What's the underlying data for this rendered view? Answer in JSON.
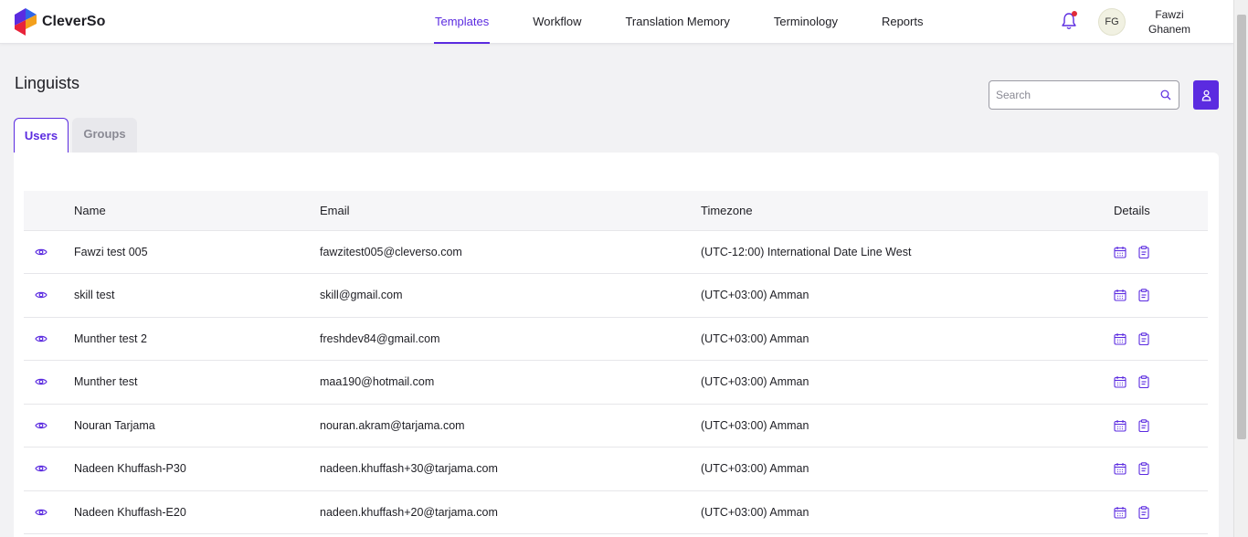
{
  "brand": {
    "name": "CleverSo",
    "accent": "#5b2be0"
  },
  "nav": {
    "items": [
      {
        "label": "Templates",
        "active": true
      },
      {
        "label": "Workflow",
        "active": false
      },
      {
        "label": "Translation Memory",
        "active": false
      },
      {
        "label": "Terminology",
        "active": false
      },
      {
        "label": "Reports",
        "active": false
      }
    ]
  },
  "user": {
    "initials": "FG",
    "first_name": "Fawzi",
    "last_name": "Ghanem"
  },
  "page": {
    "title": "Linguists"
  },
  "search": {
    "placeholder": "Search",
    "value": ""
  },
  "tabs": [
    {
      "label": "Users",
      "active": true
    },
    {
      "label": "Groups",
      "active": false
    }
  ],
  "table": {
    "headers": {
      "name": "Name",
      "email": "Email",
      "timezone": "Timezone",
      "details": "Details"
    },
    "rows": [
      {
        "name": "Fawzi test 005",
        "email": "fawzitest005@cleverso.com",
        "timezone": "(UTC-12:00) International Date Line West"
      },
      {
        "name": "skill test",
        "email": "skill@gmail.com",
        "timezone": "(UTC+03:00) Amman"
      },
      {
        "name": "Munther test 2",
        "email": "freshdev84@gmail.com",
        "timezone": "(UTC+03:00) Amman"
      },
      {
        "name": "Munther test",
        "email": "maa190@hotmail.com",
        "timezone": "(UTC+03:00) Amman"
      },
      {
        "name": "Nouran Tarjama",
        "email": "nouran.akram@tarjama.com",
        "timezone": "(UTC+03:00) Amman"
      },
      {
        "name": "Nadeen Khuffash-P30",
        "email": "nadeen.khuffash+30@tarjama.com",
        "timezone": "(UTC+03:00) Amman"
      },
      {
        "name": "Nadeen Khuffash-E20",
        "email": "nadeen.khuffash+20@tarjama.com",
        "timezone": "(UTC+03:00) Amman"
      }
    ]
  },
  "icons": {
    "row_view": "eye-icon",
    "details": [
      "calendar-icon",
      "clipboard-icon"
    ],
    "notification": "bell-icon",
    "search": "search-icon",
    "add_user": "user-icon"
  }
}
